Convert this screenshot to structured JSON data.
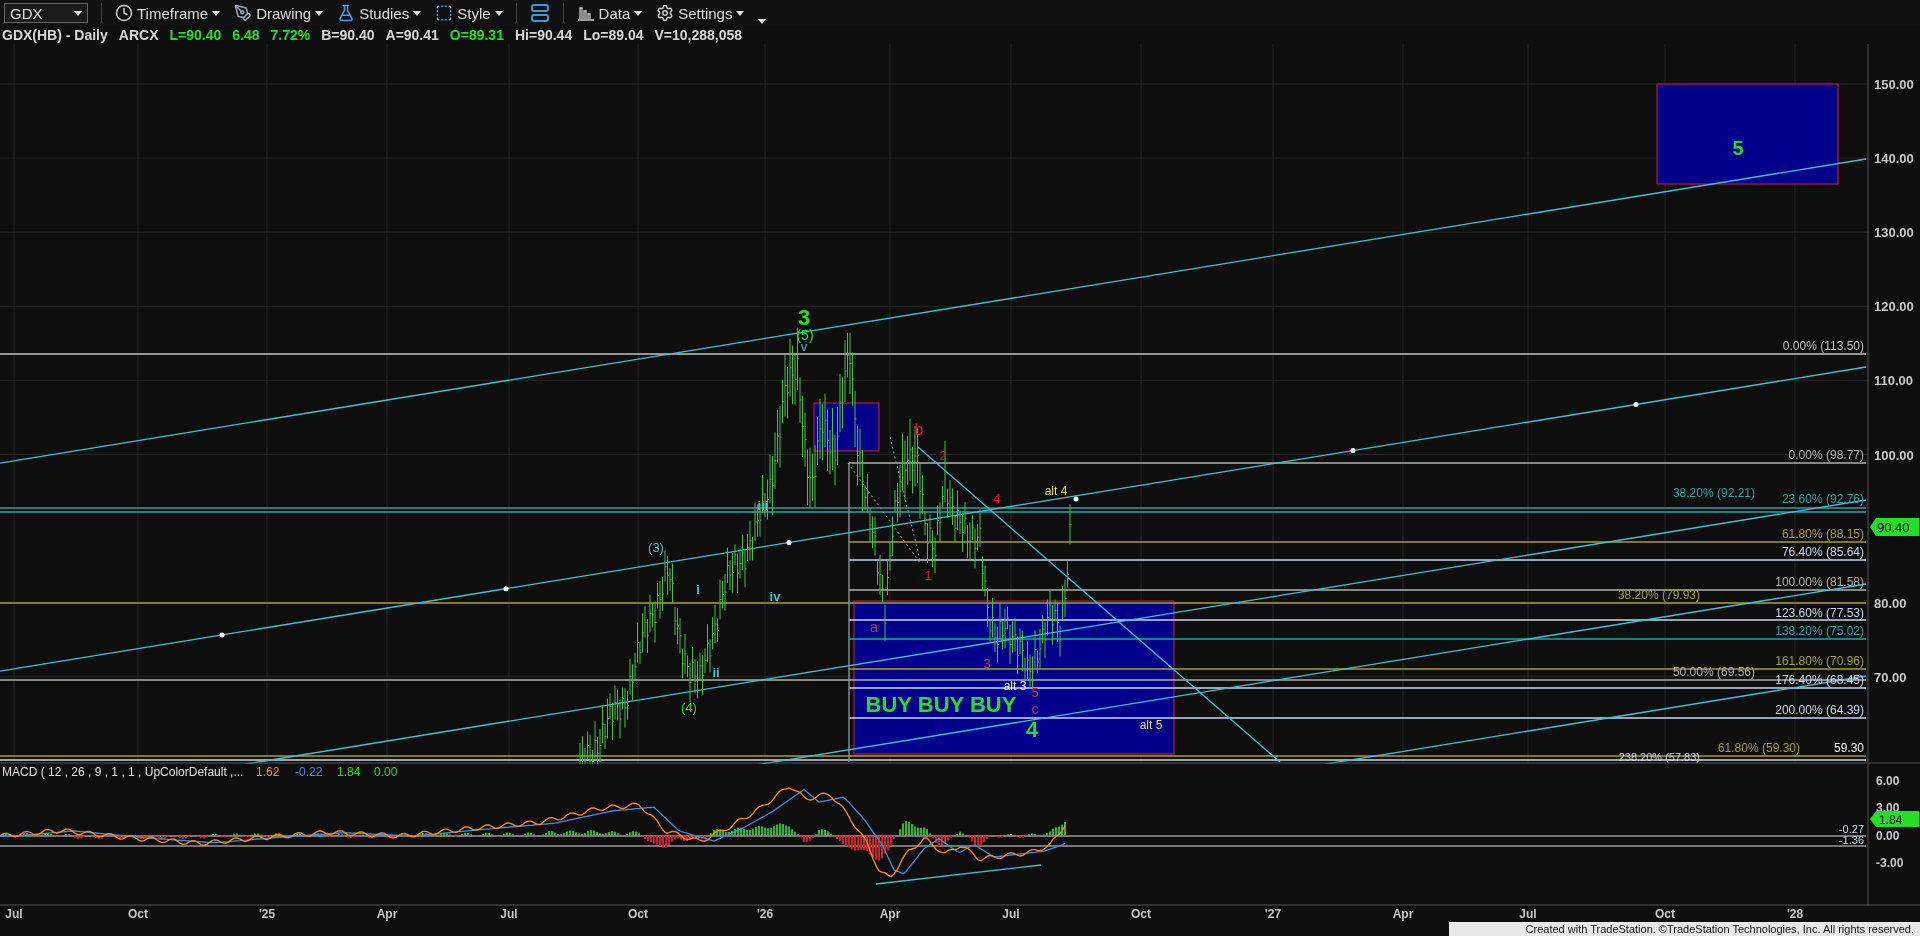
{
  "toolbar": {
    "symbol": "GDX",
    "menus": [
      {
        "label": "Timeframe"
      },
      {
        "label": "Drawing"
      },
      {
        "label": "Studies"
      },
      {
        "label": "Style"
      },
      {
        "label": "Data"
      },
      {
        "label": "Settings"
      }
    ]
  },
  "quote_line": [
    {
      "text": "GDX(HB) - Daily",
      "color": "#d8d8d8"
    },
    {
      "text": "ARCX",
      "color": "#d8d8d8"
    },
    {
      "text": "L=90.40",
      "color": "#22e022"
    },
    {
      "text": "6.48",
      "color": "#22e022"
    },
    {
      "text": "7.72%",
      "color": "#22e022"
    },
    {
      "text": "B=90.40",
      "color": "#d8d8d8"
    },
    {
      "text": "A=90.41",
      "color": "#d8d8d8"
    },
    {
      "text": "O=89.31",
      "color": "#22e022"
    },
    {
      "text": "Hi=90.44",
      "color": "#d8d8d8"
    },
    {
      "text": "Lo=89.04",
      "color": "#d8d8d8"
    },
    {
      "text": "V=10,288,058",
      "color": "#d8d8d8"
    }
  ],
  "price_axis": {
    "labels": [
      "150.00",
      "140.00",
      "130.00",
      "120.00",
      "110.00",
      "100.00",
      "80.00",
      "70.00"
    ],
    "last_price": "90.40",
    "marker": "59.30"
  },
  "fib_levels": [
    {
      "label": "0.00% (113.50)",
      "color": "#c4c4c4"
    },
    {
      "label": "0.00% (98.77)",
      "color": "#b0b0b0"
    },
    {
      "label": "23.60% (92.76)",
      "color": "#2aa0a8"
    },
    {
      "label": "38.20% (92.21)",
      "color": "#2aa0a8"
    },
    {
      "label": "61.80% (88.15)",
      "color": "#a89e30"
    },
    {
      "label": "76.40% (85.64)",
      "color": "#c8d8f0"
    },
    {
      "label": "100.00% (81.58)",
      "color": "#b0b0b0"
    },
    {
      "label": "38.20% (79.93)",
      "color": "#a89e30"
    },
    {
      "label": "123.60% (77.53)",
      "color": "#c8d8f0"
    },
    {
      "label": "138.20% (75.02)",
      "color": "#2aa0a8"
    },
    {
      "label": "161.80% (70.96)",
      "color": "#a89e30"
    },
    {
      "label": "50.00% (69.56)",
      "color": "#b0b0b0"
    },
    {
      "label": "176.40% (68.45)",
      "color": "#c8d8f0"
    },
    {
      "label": "200.00% (64.39)",
      "color": "#c8d8f0"
    },
    {
      "label": "61.80% (59.30)",
      "color": "#a89e30"
    },
    {
      "label": "238.20% (57.83)",
      "color": "#c8d8f0"
    }
  ],
  "annotations": [
    {
      "text": "3",
      "color": "#22e022"
    },
    {
      "text": "(5)",
      "color": "#22e022"
    },
    {
      "text": "v",
      "color": "#3cc4d4"
    },
    {
      "text": "(3)",
      "color": "#3cc4d4"
    },
    {
      "text": "iii",
      "color": "#3cc4d4"
    },
    {
      "text": "i",
      "color": "#3cc4d4"
    },
    {
      "text": "iv",
      "color": "#3cc4d4"
    },
    {
      "text": "ii",
      "color": "#3cc4d4"
    },
    {
      "text": "(4)",
      "color": "#22e022"
    },
    {
      "text": "b",
      "color": "#e01818"
    },
    {
      "text": "2",
      "color": "#e01818"
    },
    {
      "text": "4",
      "color": "#e01818"
    },
    {
      "text": "alt 4",
      "color": "#f0e040"
    },
    {
      "text": "1",
      "color": "#e01818"
    },
    {
      "text": "a",
      "color": "#d8284a"
    },
    {
      "text": "3",
      "color": "#d8284a"
    },
    {
      "text": "alt 3",
      "color": "#f0f0f0"
    },
    {
      "text": "5",
      "color": "#d8284a"
    },
    {
      "text": "BUY BUY BUY",
      "color": "#22e022"
    },
    {
      "text": "c",
      "color": "#d8284a"
    },
    {
      "text": "4",
      "color": "#22e022"
    },
    {
      "text": "alt 5",
      "color": "#f0e040"
    },
    {
      "text": "5",
      "color": "#22e022"
    }
  ],
  "macd": {
    "title": "MACD ( 12 , 26 , 9 , 1 , 1 , UpColorDefault ,...",
    "values": [
      {
        "text": "1.62",
        "color": "#ff8c1a"
      },
      {
        "text": "-0.22",
        "color": "#3d8fe0"
      },
      {
        "text": "1.84",
        "color": "#22e022"
      },
      {
        "text": "0.00",
        "color": "#22e022"
      }
    ],
    "axis_labels": [
      "6.00",
      "3.00",
      "0.00",
      "-3.00"
    ],
    "last_value": "1.84",
    "reference_labels": [
      "-0.27",
      "-1.36"
    ]
  },
  "time_axis": [
    "Jul",
    "Oct",
    "'25",
    "Apr",
    "Jul",
    "Oct",
    "'26",
    "Apr",
    "Jul",
    "Oct",
    "'27",
    "Apr",
    "Jul",
    "Oct",
    "'28"
  ],
  "footer": "Created with TradeStation. ©TradeStation Technologies, Inc. All rights reserved."
}
